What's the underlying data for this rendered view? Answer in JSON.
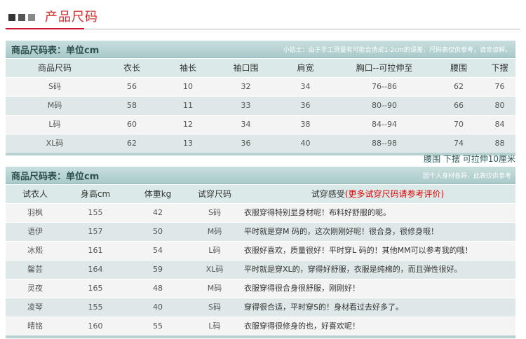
{
  "header": {
    "title": "产品尺码"
  },
  "size_table": {
    "title": "商品尺码表：单位cm",
    "note": "小贴士：由于手工测量有可能会造成1-2cm的误差，尺码表仅供参考，请亲谅解。",
    "columns": [
      "商品尺码",
      "衣长",
      "袖长",
      "袖口围",
      "肩宽",
      "胸口--可拉伸至",
      "腰围",
      "下摆"
    ],
    "rows": [
      [
        "S码",
        "56",
        "10",
        "32",
        "34",
        "76--86",
        "62",
        "76"
      ],
      [
        "M码",
        "58",
        "11",
        "33",
        "36",
        "80--90",
        "66",
        "80"
      ],
      [
        "L码",
        "60",
        "12",
        "34",
        "38",
        "84--94",
        "70",
        "84"
      ],
      [
        "XL码",
        "62",
        "13",
        "36",
        "40",
        "88--98",
        "74",
        "88"
      ]
    ]
  },
  "stretch_note": "腰围 下摆 可拉伸10厘米",
  "tryon_table": {
    "title": "商品尺码表：单位cm",
    "note": "因个人身材各异，此表仅供参考",
    "columns": [
      "试衣人",
      "身高cm",
      "体重kg",
      "试穿尺码",
      "试穿感受"
    ],
    "columns_red_suffix": "(更多试穿尺码请参考评价)",
    "rows": [
      [
        "羽枫",
        "155",
        "42",
        "S码",
        "衣服穿得特别显身材呢！布料好舒服的呢。"
      ],
      [
        "语伊",
        "157",
        "50",
        "M码",
        "平时就是穿M 码的，这次刚刚好呢！很合身，很修身哦！"
      ],
      [
        "冰熙",
        "161",
        "54",
        "L码",
        "衣服好喜欢，质量很好！平时穿L 码的！其他MM可以参考我的哦！"
      ],
      [
        "馨芸",
        "164",
        "59",
        "XL码",
        "平时就是穿XL的，穿得好舒服，衣服是纯棉的，而且弹性很好。"
      ],
      [
        "灵夜",
        "165",
        "48",
        "M码",
        "衣服穿得很合身很舒服，刚刚好！"
      ],
      [
        "凌琴",
        "155",
        "40",
        "S码",
        "穿得很合适，平时穿S的！身材看过去好多了。"
      ],
      [
        "晴铭",
        "160",
        "55",
        "L码",
        "衣服穿得很修身的也，好喜欢呢！"
      ]
    ]
  }
}
